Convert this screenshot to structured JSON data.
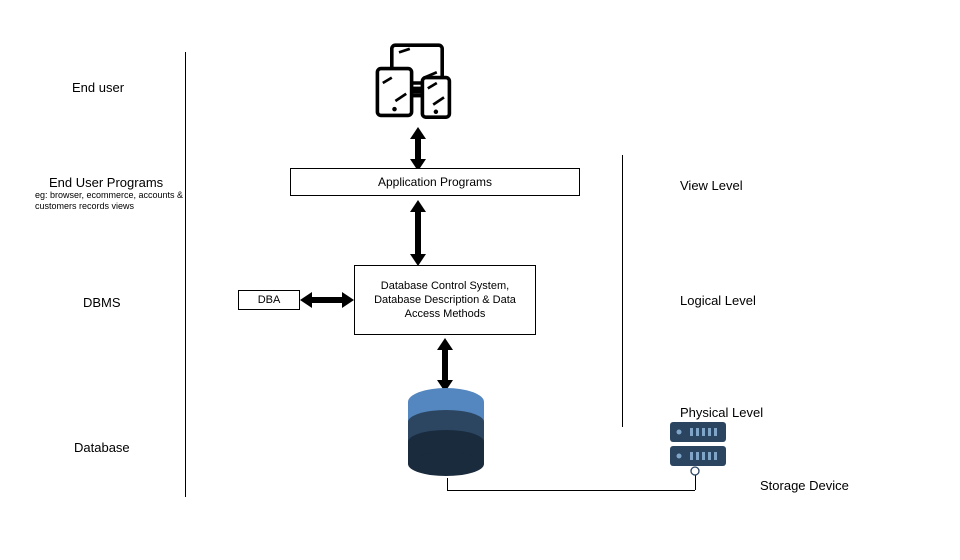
{
  "left_labels": {
    "end_user": "End user",
    "end_user_programs": "End User Programs",
    "end_user_programs_sub": "eg: browser, ecommerce, accounts & customers records views",
    "dbms": "DBMS",
    "database": "Database"
  },
  "right_labels": {
    "view_level": "View Level",
    "logical_level": "Logical Level",
    "physical_level": "Physical Level",
    "storage_device": "Storage Device"
  },
  "boxes": {
    "application_programs": "Application Programs",
    "dba": "DBA",
    "dbms_core": "Database Control System, Database Description & Data Access Methods"
  }
}
